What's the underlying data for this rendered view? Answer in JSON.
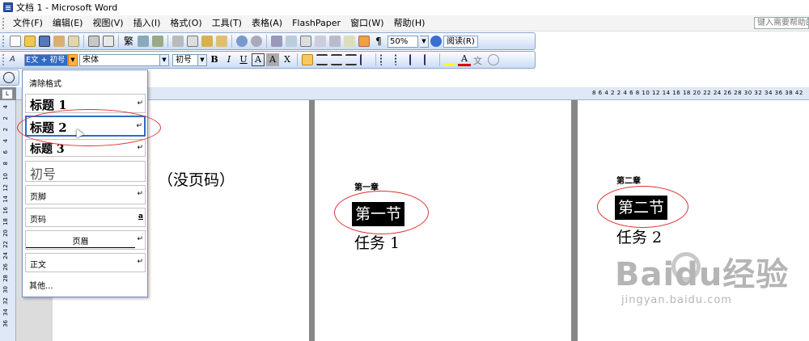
{
  "window": {
    "title": "文档 1 - Microsoft Word"
  },
  "menu": {
    "items": [
      "文件(F)",
      "编辑(E)",
      "视图(V)",
      "插入(I)",
      "格式(O)",
      "工具(T)",
      "表格(A)",
      "FlashPaper",
      "窗口(W)",
      "帮助(H)"
    ],
    "help_placeholder": "键入需要帮助的"
  },
  "toolbar": {
    "zoom": "50%",
    "read_label": "阅读(R)"
  },
  "format_bar": {
    "style": "E文 + 初号",
    "font": "宋体",
    "size": "初号"
  },
  "ruler": {
    "numbers": "8 6 4 2   2 4 6 8 10 12 14 16 18 20 22 24 26 28 30 32 34 36 38 42",
    "vertical": [
      "4",
      "2",
      "2",
      "4",
      "6",
      "8",
      "10",
      "12",
      "14",
      "16",
      "18",
      "20",
      "22",
      "24",
      "26",
      "28",
      "30",
      "32",
      "34",
      "36"
    ]
  },
  "style_dropdown": {
    "clear": "清除格式",
    "items": [
      {
        "label": "标题 1",
        "mark": "↵"
      },
      {
        "label": "标题 2",
        "mark": "↵"
      },
      {
        "label": "标题 3",
        "mark": "↵"
      },
      {
        "label": "初号",
        "mark": ""
      },
      {
        "label": "页脚",
        "mark": "↵"
      },
      {
        "label": "页码",
        "mark": "a"
      },
      {
        "label": "页眉",
        "mark": "↵"
      },
      {
        "label": "正文",
        "mark": "↵"
      }
    ],
    "more": "其他..."
  },
  "document": {
    "page1": {
      "text": "（没页码）"
    },
    "page2": {
      "chapter": "第一章",
      "section": "第一节",
      "task": "任务 1"
    },
    "page3": {
      "chapter": "第二章",
      "section": "第二节",
      "task": "任务 2"
    }
  },
  "watermark": {
    "main": "Baidu经验",
    "sub": "jingyan.baidu.com"
  },
  "colors": {
    "highlight": "#316ac5",
    "annotation": "#e03030",
    "toolbar_bg": "#cbdcf5"
  }
}
